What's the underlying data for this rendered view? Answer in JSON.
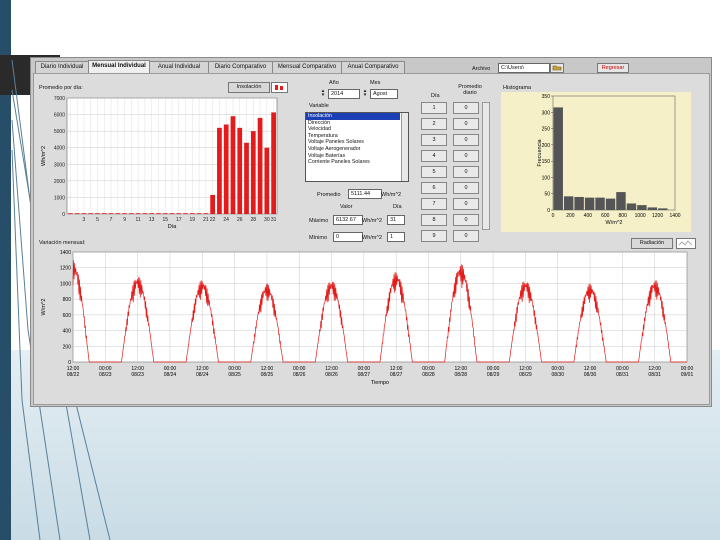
{
  "tabs": [
    "Diario Individual",
    "Mensual Individual",
    "Anual Individual",
    "Diario Comparativo",
    "Mensual Comparativo",
    "Anual Comparativo"
  ],
  "active_tab": 1,
  "file": {
    "label": "Archivo",
    "path": "C:\\Users\\"
  },
  "return_button": "Regresar",
  "daily_panel": {
    "title": "Promedio por día:",
    "variable_button": "Insolación",
    "ylabel": "Wh/m^2",
    "xlabel": "Día"
  },
  "year": {
    "label": "Año",
    "value": "2014"
  },
  "month": {
    "label": "Mes",
    "value": "Agost"
  },
  "variable": {
    "label": "Variable",
    "options": [
      "Insolación",
      "Dirección",
      "Velocidad",
      "Temperatura",
      "Voltaje Paneles Solares",
      "Voltaje Aerogenerador",
      "Voltaje Baterías",
      "Corriente Paneles Solares"
    ],
    "selected": 0
  },
  "promedio": {
    "label": "Promedio",
    "value": "5111.44",
    "unit": "Wh/m^2"
  },
  "stats": {
    "valor_header": "Valor",
    "dia_header": "Día",
    "max_label": "Máximo",
    "max_value": "6132.67",
    "max_unit": "Wh/m^2",
    "max_day": "31",
    "min_label": "Mínimo",
    "min_value": "0",
    "min_unit": "Wh/m^2",
    "min_day": "1"
  },
  "daily_table": {
    "dia_header": "Día",
    "prom_header": "Promedio diario",
    "days": [
      "1",
      "2",
      "3",
      "4",
      "5",
      "6",
      "7",
      "8",
      "9"
    ],
    "values": [
      "0",
      "0",
      "0",
      "0",
      "0",
      "0",
      "0",
      "0",
      "0"
    ]
  },
  "histogram": {
    "title": "Histograma",
    "ylabel": "Frecuencia",
    "xlabel": "W/m^2"
  },
  "monthly": {
    "title": "Variación mensual:",
    "radiation_button": "Radiación",
    "ylabel": "W/m^2",
    "xlabel": "Tiempo"
  },
  "colors": {
    "bar_red": "#e31b1b",
    "hist_bar": "#555555",
    "plot_bg": "#ffffff",
    "hist_bg": "#f5f0c8",
    "slide_bar": "#264e68"
  },
  "chart_data": [
    {
      "type": "bar",
      "title": "Promedio por día:",
      "xlabel": "Día",
      "ylabel": "Wh/m^2",
      "ylim": [
        0,
        7000
      ],
      "categories": [
        "1",
        "2",
        "3",
        "4",
        "5",
        "6",
        "7",
        "8",
        "9",
        "10",
        "11",
        "12",
        "13",
        "14",
        "15",
        "16",
        "17",
        "18",
        "19",
        "20",
        "21",
        "22",
        "23",
        "24",
        "25",
        "26",
        "27",
        "28",
        "29",
        "30",
        "31"
      ],
      "x_ticks": [
        "3",
        "5",
        "7",
        "9",
        "11",
        "13",
        "15",
        "17",
        "19",
        "21",
        "22",
        "24",
        "26",
        "28",
        "30",
        "31"
      ],
      "y_ticks": [
        "0",
        "1000",
        "2000",
        "3000",
        "4000",
        "5000",
        "6000",
        "7000"
      ],
      "values": [
        0,
        0,
        0,
        0,
        0,
        0,
        0,
        0,
        0,
        0,
        0,
        0,
        0,
        0,
        0,
        0,
        0,
        0,
        0,
        0,
        0,
        1150,
        5200,
        5400,
        5900,
        5200,
        4300,
        5000,
        5800,
        4000,
        6130
      ]
    },
    {
      "type": "bar",
      "title": "Histograma",
      "xlabel": "W/m^2",
      "ylabel": "Frecuencia",
      "ylim": [
        0,
        350
      ],
      "x_ticks": [
        "0",
        "200",
        "400",
        "600",
        "800",
        "1000",
        "1200",
        "1400"
      ],
      "y_ticks": [
        "0",
        "50",
        "100",
        "150",
        "200",
        "250",
        "300",
        "350"
      ],
      "bin_width": 120,
      "bins": [
        0,
        120,
        240,
        360,
        480,
        600,
        720,
        840,
        960,
        1080,
        1200,
        1320
      ],
      "values": [
        315,
        42,
        40,
        38,
        38,
        35,
        55,
        20,
        15,
        8,
        5,
        0
      ]
    },
    {
      "type": "line",
      "title": "Variación mensual:",
      "xlabel": "Tiempo",
      "ylabel": "W/m^2",
      "ylim": [
        0,
        1400
      ],
      "y_ticks": [
        "0",
        "200",
        "400",
        "600",
        "800",
        "1000",
        "1200",
        "1400"
      ],
      "x_ticks": [
        [
          "12:00",
          "08/22"
        ],
        [
          "00:00",
          "08/23"
        ],
        [
          "12:00",
          "08/23"
        ],
        [
          "00:00",
          "08/24"
        ],
        [
          "12:00",
          "08/24"
        ],
        [
          "00:00",
          "08/25"
        ],
        [
          "12:00",
          "08/25"
        ],
        [
          "00:00",
          "08/26"
        ],
        [
          "12:00",
          "08/26"
        ],
        [
          "00:00",
          "08/27"
        ],
        [
          "12:00",
          "08/27"
        ],
        [
          "00:00",
          "08/28"
        ],
        [
          "12:00",
          "08/28"
        ],
        [
          "00:00",
          "08/29"
        ],
        [
          "12:00",
          "08/29"
        ],
        [
          "00:00",
          "08/30"
        ],
        [
          "12:00",
          "08/30"
        ],
        [
          "00:00",
          "08/31"
        ],
        [
          "12:00",
          "08/31"
        ],
        [
          "00:00",
          "09/01"
        ]
      ],
      "series": [
        {
          "day_peaks": [
            1300,
            1100,
            1050,
            1000,
            1050,
            1150,
            1250,
            1050,
            1000,
            1050
          ]
        }
      ]
    }
  ]
}
